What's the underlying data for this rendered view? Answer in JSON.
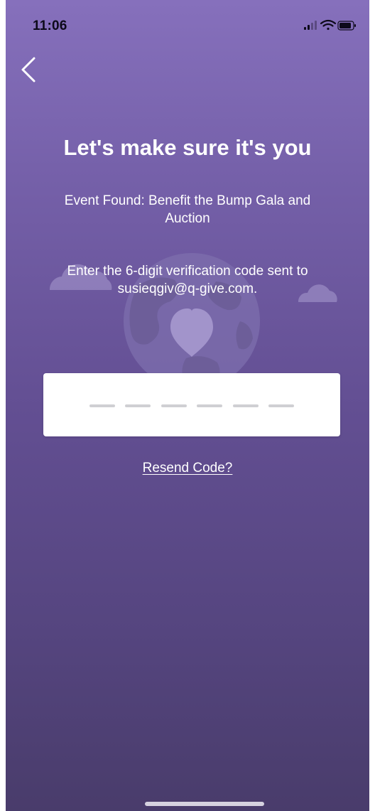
{
  "status_bar": {
    "time": "11:06",
    "icons": [
      "cellular-signal-icon",
      "wifi-icon",
      "battery-icon"
    ]
  },
  "nav": {
    "back_icon": "chevron-left-icon"
  },
  "verification": {
    "title": "Let's make sure it's you",
    "event_found": "Event Found: Benefit the Bump Gala and Auction",
    "instructions": "Enter the 6-digit verification code sent to susieqgiv@q-give.com.",
    "code_value": "",
    "code_length": 6,
    "resend_label": "Resend Code?"
  },
  "illustration": {
    "icon": "globe-heart-icon",
    "decorations": [
      "cloud-icon",
      "cloud-icon"
    ]
  },
  "colors": {
    "background_top": "#8670bc",
    "background_bottom": "#493c6b",
    "text": "#ffffff",
    "field_background": "#ffffff",
    "slot_placeholder": "#cfcfd3"
  }
}
